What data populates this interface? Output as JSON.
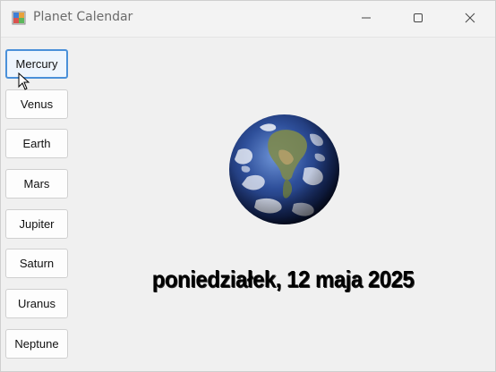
{
  "window": {
    "title": "Planet Calendar",
    "icon": "app-icon"
  },
  "controls": {
    "minimize_icon": "minimize-icon",
    "maximize_icon": "maximize-icon",
    "close_icon": "close-icon"
  },
  "planets": [
    {
      "label": "Mercury",
      "active": true
    },
    {
      "label": "Venus",
      "active": false
    },
    {
      "label": "Earth",
      "active": false
    },
    {
      "label": "Mars",
      "active": false
    },
    {
      "label": "Jupiter",
      "active": false
    },
    {
      "label": "Saturn",
      "active": false
    },
    {
      "label": "Uranus",
      "active": false
    },
    {
      "label": "Neptune",
      "active": false
    }
  ],
  "display": {
    "image": "earth-image",
    "date": "poniedziałek, 12 maja 2025"
  },
  "colors": {
    "accent": "#4a90d9",
    "background": "#f0f0f0"
  }
}
